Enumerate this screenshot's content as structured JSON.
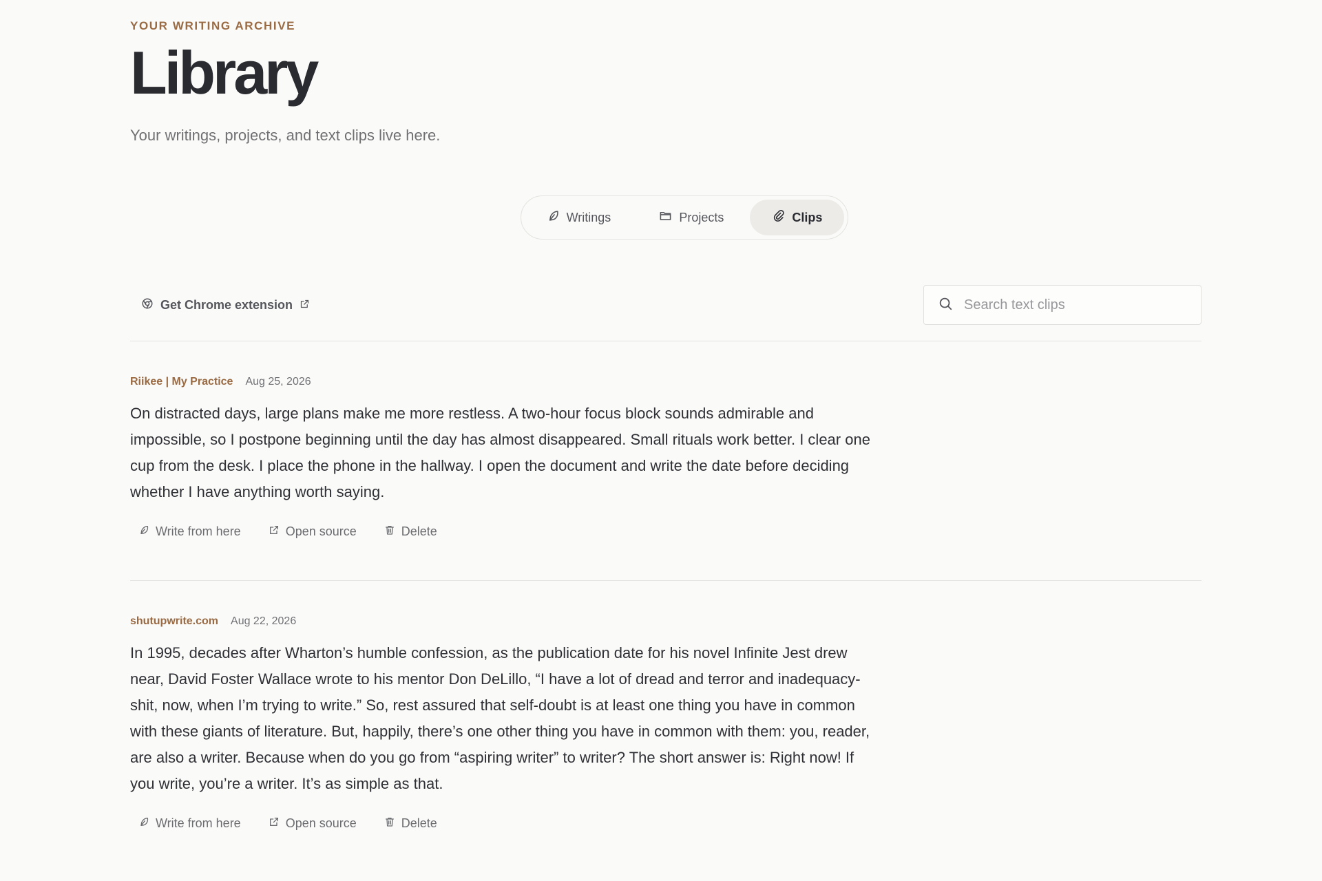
{
  "header": {
    "eyebrow": "YOUR WRITING ARCHIVE",
    "title": "Library",
    "subtitle": "Your writings, projects, and text clips live here."
  },
  "tabs": [
    {
      "label": "Writings",
      "icon": "feather-icon",
      "active": false
    },
    {
      "label": "Projects",
      "icon": "folder-icon",
      "active": false
    },
    {
      "label": "Clips",
      "icon": "paperclip-icon",
      "active": true
    }
  ],
  "toolbar": {
    "extension_label": "Get Chrome extension",
    "search_placeholder": "Search text clips",
    "search_value": ""
  },
  "clips": [
    {
      "source": "Riikee | My Practice",
      "date": "Aug 25, 2026",
      "text": "On distracted days, large plans make me more restless. A two-hour focus block sounds admirable and impossible, so I postpone beginning until the day has almost disappeared. Small rituals work better. I clear one cup from the desk. I place the phone in the hallway. I open the document and write the date before deciding whether I have anything worth saying.",
      "actions": {
        "write": "Write from here",
        "open": "Open source",
        "delete": "Delete"
      }
    },
    {
      "source": "shutupwrite.com",
      "date": "Aug 22, 2026",
      "text": "In 1995, decades after Wharton’s humble confession, as the publication date for his novel Infinite Jest drew near, David Foster Wallace wrote to his mentor Don DeLillo, “I have a lot of dread and terror and inadequacy-shit, now, when I’m trying to write.” So, rest assured that self-doubt is at least one thing you have in common with these giants of literature. But, happily, there’s one other thing you have in common with them: you, reader, are also a writer. Because when do you go from “aspiring writer” to writer? The short answer is: Right now! If you write, you’re a writer. It’s as simple as that.",
      "actions": {
        "write": "Write from here",
        "open": "Open source",
        "delete": "Delete"
      }
    }
  ],
  "colors": {
    "accent": "#9a6a43",
    "background": "#fafaf8",
    "text": "#2a2b31",
    "muted": "#6b6c70",
    "active_tab_bg": "#ecebe8"
  }
}
